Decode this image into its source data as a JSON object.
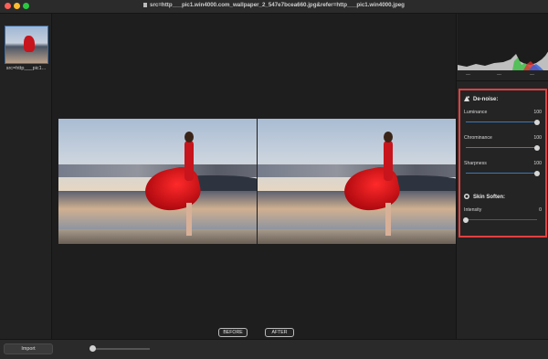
{
  "window": {
    "title": "src=http___pic1.win4000.com_wallpaper_2_547e7bcea660.jpg&refer=http___pic1.win4000.jpeg"
  },
  "sidebar": {
    "thumbnail_label": "src=http___pic1..."
  },
  "histogram": {
    "readouts": [
      "---",
      "---",
      "---"
    ]
  },
  "denoise": {
    "heading": "De-noise:",
    "sliders": [
      {
        "label": "Luminance",
        "value": "100",
        "level": 1.0
      },
      {
        "label": "Chrominance",
        "value": "100",
        "level": 1.0
      },
      {
        "label": "Sharpness",
        "value": "100",
        "level": 1.0
      }
    ]
  },
  "skin": {
    "heading": "Skin Soften:",
    "sliders": [
      {
        "label": "Intensity",
        "value": "0",
        "level": 0.0
      }
    ]
  },
  "compare": {
    "before_label": "BEFORE",
    "after_label": "AFTER"
  },
  "bottom": {
    "import_label": "Import",
    "zoom_level": 0.0
  },
  "colors": {
    "highlight": "#e04040",
    "slider_active": "#3b78b8"
  }
}
